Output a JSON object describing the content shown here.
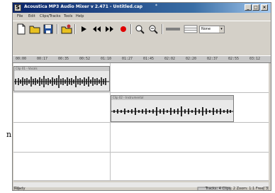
{
  "window": {
    "title": "Acoustica MP3 Audio Mixer v 2.471 - Untitled.cap",
    "app_icon_glyph": "S",
    "title_indicator": "*",
    "controls": [
      "minimize",
      "maximize",
      "close"
    ],
    "control_glyphs": [
      "_",
      "□",
      "×"
    ]
  },
  "menu": {
    "items": [
      "File",
      "Edit",
      "Clips/Tracks",
      "Tools",
      "Help"
    ]
  },
  "toolbar": {
    "buttons": [
      "new-file-icon",
      "open-folder-icon",
      "save-icon",
      "import-audio-icon",
      "play-icon",
      "rewind-icon",
      "fast-forward-icon",
      "record-icon",
      "zoom-in-icon",
      "zoom-out-icon",
      "waveform-view-icon",
      "grid-view-icon"
    ],
    "zoom_value": "None",
    "zoom_arrow": "▾"
  },
  "ruler": {
    "labels": [
      "00:00",
      "00:17",
      "00:35",
      "00:52",
      "01:10",
      "01:27",
      "01:45",
      "02:02",
      "02:20",
      "02:37",
      "02:55",
      "03:12"
    ]
  },
  "tracks": [
    {
      "clip_title": "Clip 01 - Vocals"
    },
    {
      "clip_title": "Clip 02 - Instrumental"
    }
  ],
  "status": {
    "left": "Ready",
    "right": "Tracks: 4   Clips: 2   Zoom: 1:1   Free: 3"
  },
  "outside_text": "n",
  "colors": {
    "titlebar": "#0a246a",
    "record": "#e00000",
    "waveform": "#111111"
  }
}
